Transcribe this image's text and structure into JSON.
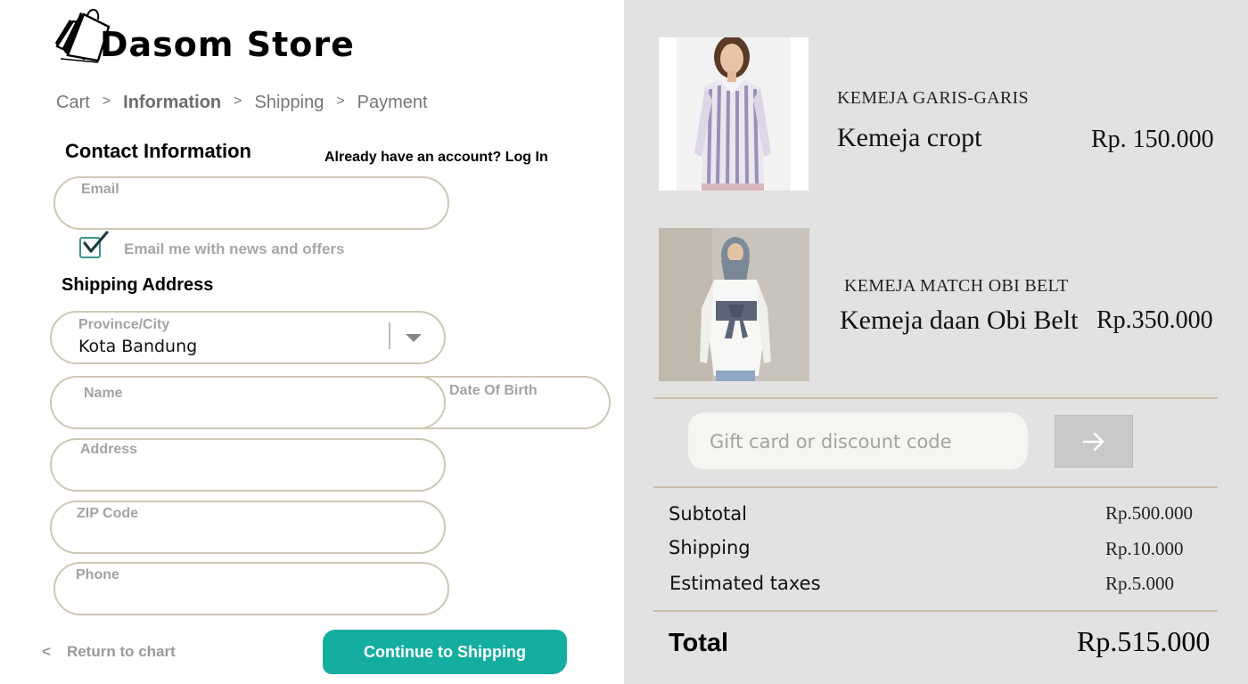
{
  "brand": {
    "name": "Dasom Store",
    "logo_icon": "shopping-bags-icon"
  },
  "breadcrumb": [
    {
      "label": "Cart",
      "active": false
    },
    {
      "label": "Information",
      "active": true
    },
    {
      "label": "Shipping",
      "active": false
    },
    {
      "label": "Payment",
      "active": false
    }
  ],
  "breadcrumb_separator": ">",
  "contact": {
    "heading": "Contact Information",
    "login_prompt": "Already have an account? Log In",
    "email_label": "Email",
    "email_value": "",
    "newsletter_label": "Email me with news and offers",
    "newsletter_checked": true
  },
  "shipping": {
    "heading": "Shipping Address",
    "province_label": "Province/City",
    "province_value": "Kota Bandung",
    "name_label": "Name",
    "dob_label": "Date Of Birth",
    "address_label": "Address",
    "zip_label": "ZIP Code",
    "phone_label": "Phone"
  },
  "actions": {
    "return_arrow": "<",
    "return_label": "Return to chart",
    "continue_label": "Continue to Shipping"
  },
  "cart": {
    "items": [
      {
        "category": "KEMEJA GARIS-GARIS",
        "name": "Kemeja cropt",
        "price": "Rp. 150.000"
      },
      {
        "category": "KEMEJA MATCH OBI BELT",
        "name": "Kemeja daan Obi Belt",
        "price": "Rp.350.000"
      }
    ],
    "discount_placeholder": "Gift card or discount code",
    "apply_icon": "arrow-right-icon",
    "summary": [
      {
        "label": "Subtotal",
        "value": "Rp.500.000"
      },
      {
        "label": "Shipping",
        "value": "Rp.10.000"
      },
      {
        "label": "Estimated taxes",
        "value": "Rp.5.000"
      }
    ],
    "total_label": "Total",
    "total_value": "Rp.515.000"
  },
  "colors": {
    "accent": "#14aea1",
    "field_border": "#cfc8b4",
    "panel_bg": "#e2e2e2",
    "divider": "#cbbfa7"
  }
}
